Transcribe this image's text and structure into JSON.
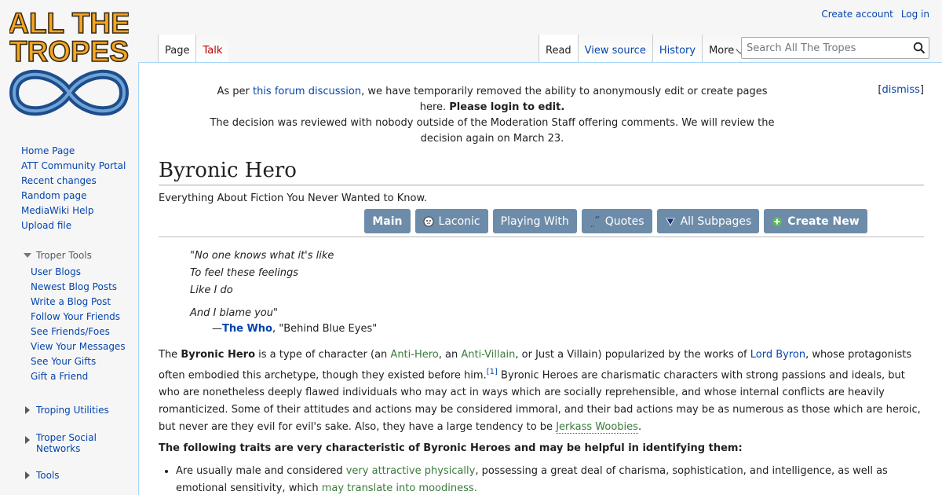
{
  "logo": {
    "line1": "ALL THE",
    "line2": "TROPES"
  },
  "personal": {
    "create_account": "Create account",
    "log_in": "Log in"
  },
  "tabs": {
    "page": "Page",
    "talk": "Talk",
    "read": "Read",
    "view_source": "View source",
    "history": "History",
    "more": "More"
  },
  "search": {
    "placeholder": "Search All The Tropes"
  },
  "sidebar": {
    "nav": [
      "Home Page",
      "ATT Community Portal",
      "Recent changes",
      "Random page",
      "MediaWiki Help",
      "Upload file"
    ],
    "troper_tools": {
      "title": "Troper Tools",
      "items": [
        "User Blogs",
        "Newest Blog Posts",
        "Write a Blog Post",
        "Follow Your Friends",
        "See Friends/Foes",
        "View Your Messages",
        "See Your Gifts",
        "Gift a Friend"
      ]
    },
    "troping_utilities": "Troping Utilities",
    "troper_social_1": "Troper Social",
    "troper_social_2": "Networks",
    "tools": "Tools"
  },
  "notice": {
    "pre": "As per ",
    "link": "this forum discussion",
    "mid": ", we have temporarily removed the ability to anonymously edit or create pages here. ",
    "bold": "Please login to edit.",
    "line2": "The decision was reviewed with nobody outside of the Moderation Staff offering comments. We will review the decision again on March 23.",
    "dismiss": "dismiss"
  },
  "page": {
    "title": "Byronic Hero",
    "tagline": "Everything About Fiction You Never Wanted to Know."
  },
  "subpages": {
    "main": "Main",
    "laconic": "Laconic",
    "playing_with": "Playing With",
    "quotes": "Quotes",
    "all_subpages": "All Subpages",
    "create_new": "Create New"
  },
  "quote": {
    "lines": [
      "\"No one knows what it's like",
      "To feel these feelings",
      "Like I do",
      "And I blame you\""
    ],
    "dash": "—",
    "who": "The Who",
    "song": ", \"Behind Blue Eyes\""
  },
  "intro": {
    "t1": "The ",
    "bold": "Byronic Hero",
    "t2": " is a type of character (an ",
    "anti_hero": "Anti-Hero",
    "t3": ", an ",
    "anti_villain": "Anti-Villain",
    "t4": ", or Just a Villain) popularized by the works of ",
    "lord_byron": "Lord Byron",
    "t5": ", whose protagonists often embodied this archetype, though they existed before him.",
    "ref": "[1]",
    "t6": " Byronic Heroes are charismatic characters with strong passions and ideals, but who are nonetheless deeply flawed individuals who may act in ways which are socially reprehensible, and whose internal conflicts are heavily romanticized. Some of their attitudes and actions may be considered immoral, and their bad actions may be as numerous as those which are heroic, but never are they evil for evil's sake. Also, they have a large tendency to be ",
    "jerkass": "Jerkass Woobies",
    "t7": "."
  },
  "traits": {
    "heading": "The following traits are very characteristic of Byronic Heroes and may be helpful in identifying them:",
    "item1_pre": "Are usually male and considered ",
    "item1_link1": "very attractive physically",
    "item1_mid": ", possessing a great deal of charisma, sophistication, and intelligence, as well as emotional sensitivity, which ",
    "item1_link2": "may translate into moodiness."
  },
  "colors": {
    "link": "#0645ad",
    "trope_link": "#3a7a3a",
    "button": "#6d8ca9",
    "logo_orange": "#f5a623",
    "logo_blue": "#1d4d8a"
  }
}
